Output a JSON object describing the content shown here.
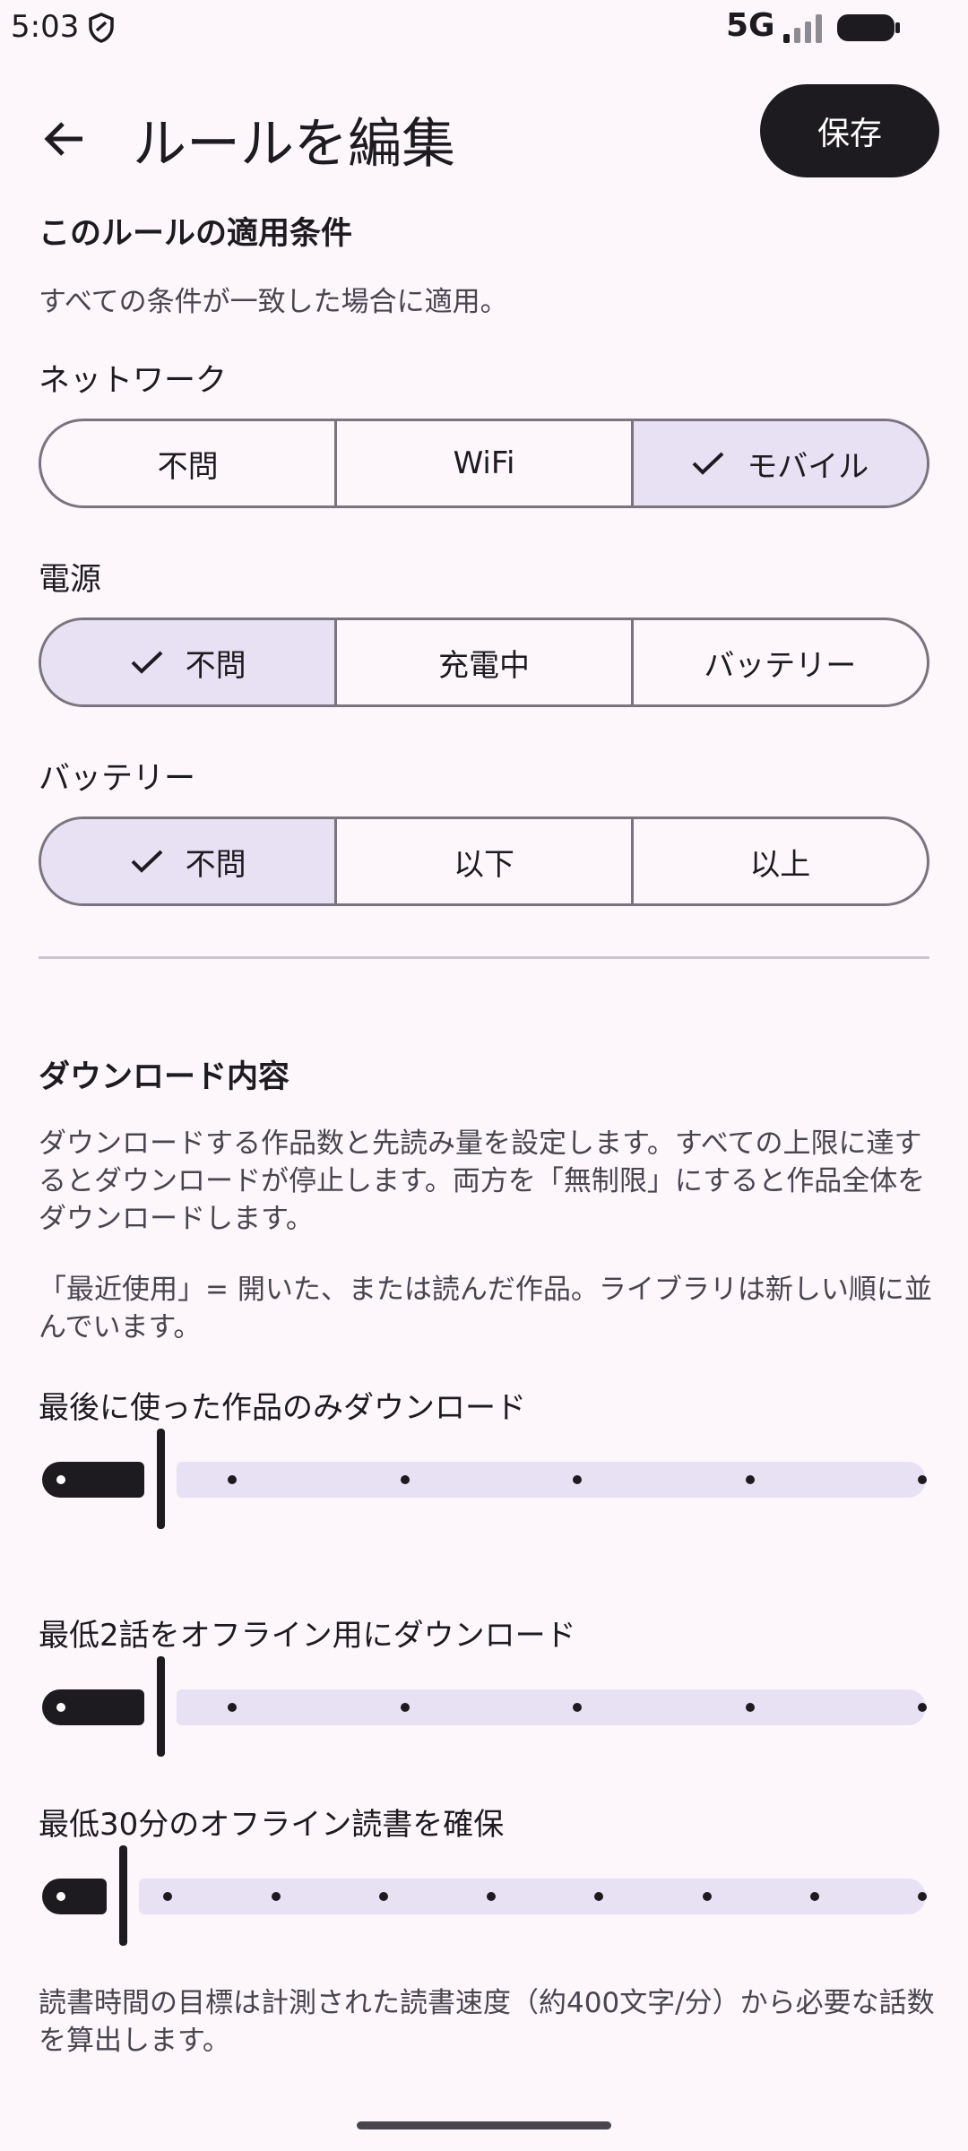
{
  "status_bar": {
    "time": "5:03",
    "network": "5G",
    "icons": [
      "shield-icon",
      "signal-icon",
      "battery-icon"
    ]
  },
  "header": {
    "title": "ルールを編集",
    "save_label": "保存",
    "back_icon": "arrow-back-icon"
  },
  "conditions": {
    "title": "このルールの適用条件",
    "description": "すべての条件が一致した場合に適用。",
    "network": {
      "label": "ネットワーク",
      "options": [
        "不問",
        "WiFi",
        "モバイル"
      ],
      "selected": "モバイル"
    },
    "power": {
      "label": "電源",
      "options": [
        "不問",
        "充電中",
        "バッテリー"
      ],
      "selected": "不問"
    },
    "battery": {
      "label": "バッテリー",
      "options": [
        "不問",
        "以下",
        "以上"
      ],
      "selected": "不問"
    }
  },
  "download": {
    "title": "ダウンロード内容",
    "description1": "ダウンロードする作品数と先読み量を設定します。すべての上限に達するとダウンロードが停止します。両方を「無制限」にすると作品全体をダウンロードします。",
    "description2": "「最近使用」= 開いた、または読んだ作品。ライブラリは新しい順に並んでいます。",
    "sliders": [
      {
        "label": "最後に使った作品のみダウンロード",
        "steps": 6,
        "value_index": 0
      },
      {
        "label": "最低2話をオフライン用にダウンロード",
        "steps": 6,
        "value_index": 0
      },
      {
        "label": "最低30分のオフライン読書を確保",
        "steps": 9,
        "value_index": 0
      }
    ],
    "footnote": "読書時間の目標は計測された読書速度（約400文字/分）から必要な話数を算出します。"
  },
  "colors": {
    "background": "#fdf7fc",
    "accent_dark": "#1d1b20",
    "selected_fill": "#e8e0f3",
    "outline": "#79747e"
  }
}
